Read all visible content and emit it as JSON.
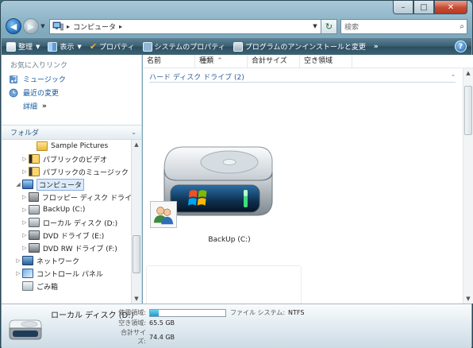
{
  "window": {
    "caption_buttons": [
      "–",
      "□",
      "✕"
    ]
  },
  "nav": {
    "address_crumb": "コンピュータ",
    "search_placeholder": "検索"
  },
  "commands": [
    {
      "label": "整理",
      "icon": "organize-icon",
      "has_dropdown": true
    },
    {
      "label": "表示",
      "icon": "views-icon",
      "has_dropdown": true
    },
    {
      "label": "プロパティ",
      "icon": "properties-check-icon",
      "has_dropdown": false
    },
    {
      "label": "システムのプロパティ",
      "icon": "system-properties-icon",
      "has_dropdown": false
    },
    {
      "label": "プログラムのアンインストールと変更",
      "icon": "uninstall-programs-icon",
      "has_dropdown": false
    }
  ],
  "command_more": "»",
  "help_label": "?",
  "favorites": {
    "header": "お気に入りリンク",
    "items": [
      {
        "label": "ミュージック",
        "icon": "music-icon"
      },
      {
        "label": "最近の変更",
        "icon": "recent-changes-icon"
      }
    ],
    "more_label": "詳細",
    "more_chevron": "»"
  },
  "folders": {
    "header": "フォルダ",
    "tree": [
      {
        "label": "Sample Pictures",
        "expander": "",
        "icon": "folder-icon",
        "indent": 3
      },
      {
        "label": "パブリックのビデオ",
        "expander": "▷",
        "icon": "video-folder-icon",
        "indent": 2
      },
      {
        "label": "パブリックのミュージック",
        "expander": "▷",
        "icon": "music-folder-icon",
        "indent": 2
      },
      {
        "label": "コンピュータ",
        "expander": "◢",
        "icon": "computer-icon",
        "indent": 0,
        "selected": true
      },
      {
        "label": "フロッピー ディスク ドライ",
        "expander": "▷",
        "icon": "floppy-drive-icon",
        "indent": 1
      },
      {
        "label": "BackUp (C:)",
        "expander": "▷",
        "icon": "hard-disk-icon",
        "indent": 1
      },
      {
        "label": "ローカル ディスク (D:)",
        "expander": "▷",
        "icon": "hard-disk-icon",
        "indent": 1
      },
      {
        "label": "DVD ドライブ (E:)",
        "expander": "▷",
        "icon": "dvd-drive-icon",
        "indent": 1
      },
      {
        "label": "DVD RW ドライブ (F:)",
        "expander": "▷",
        "icon": "dvd-rw-drive-icon",
        "indent": 1
      },
      {
        "label": "ネットワーク",
        "expander": "▷",
        "icon": "network-icon",
        "indent": 0
      },
      {
        "label": "コントロール パネル",
        "expander": "▷",
        "icon": "control-panel-icon",
        "indent": 0
      },
      {
        "label": "ごみ箱",
        "expander": "",
        "icon": "recycle-bin-icon",
        "indent": 0
      }
    ]
  },
  "columns": [
    "名前",
    "種類",
    "合計サイズ",
    "空き領域"
  ],
  "group": {
    "label": "ハード ディスク ドライブ (2)",
    "collapse_glyph": "⌃"
  },
  "drive_item": {
    "label": "BackUp (C:)",
    "icon": "hard-disk-large-icon",
    "overlay_icon": "shared-users-icon"
  },
  "details": {
    "name": "ローカル ディスク (D:)",
    "used_label": "使用領域:",
    "used_fraction": 0.12,
    "free_label": "空き領域:",
    "free_value": "65.5 GB",
    "total_label": "合計サイズ:",
    "total_value": "74.4 GB",
    "fs_label": "ファイル システム:",
    "fs_value": "NTFS"
  }
}
